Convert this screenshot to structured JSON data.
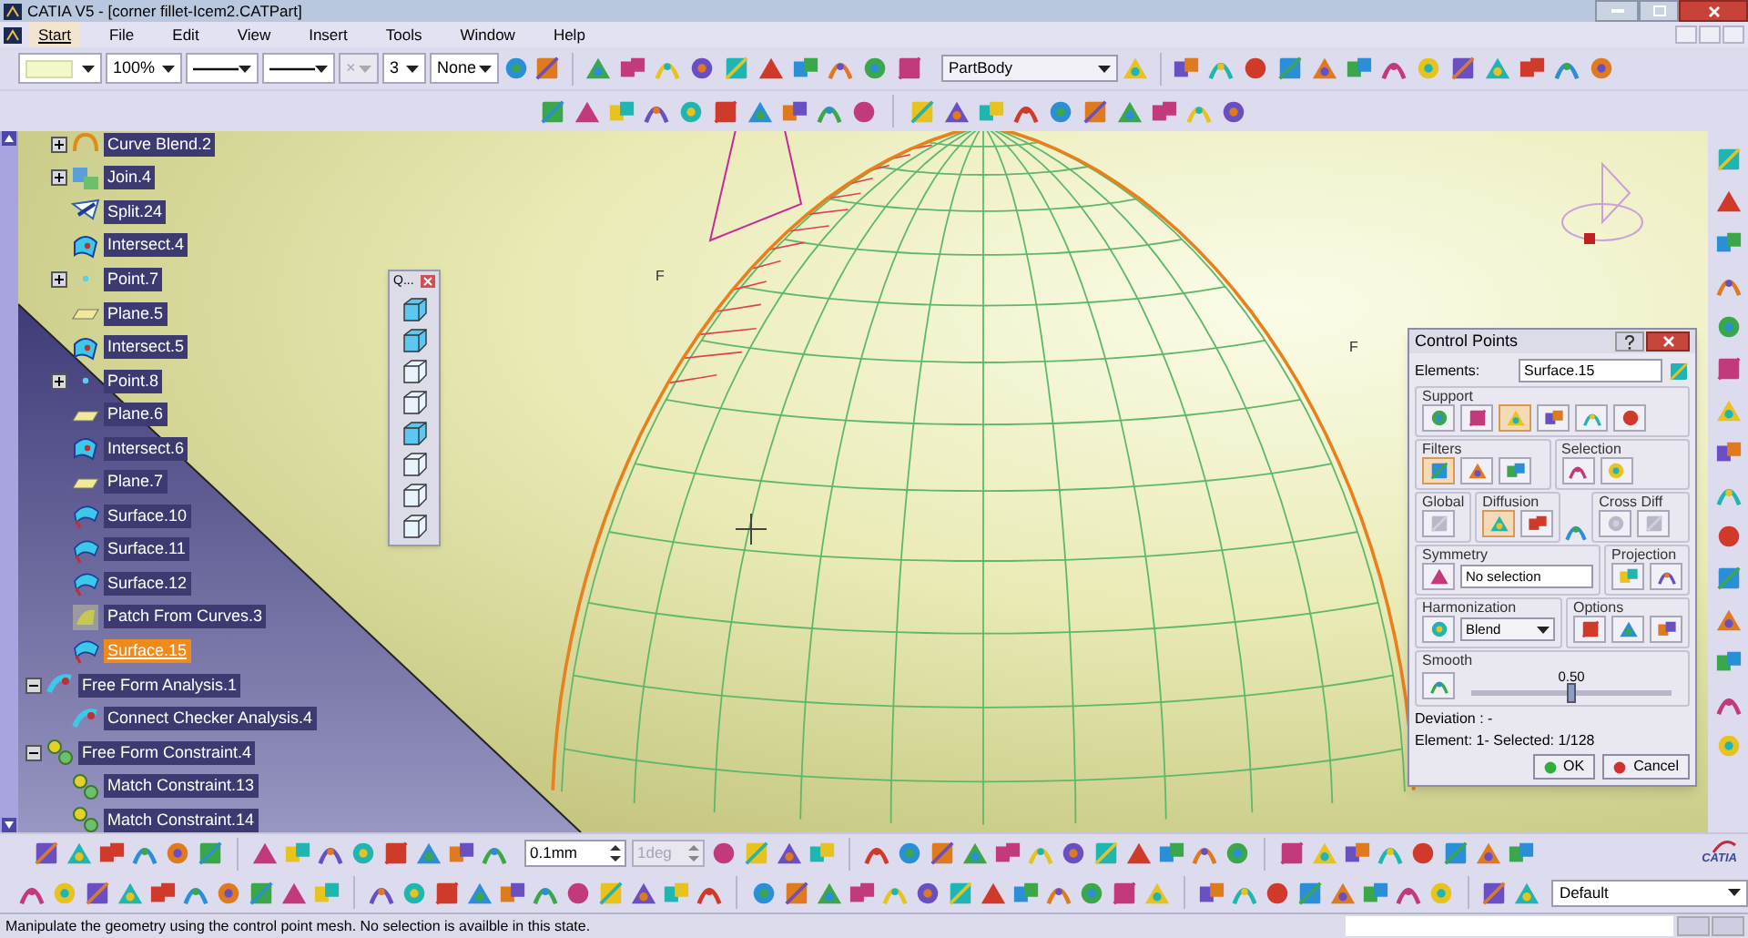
{
  "window": {
    "title": "CATIA V5 - [corner fillet-Icem2.CATPart]"
  },
  "menu": [
    {
      "label": "Start",
      "selected": true
    },
    {
      "label": "File",
      "selected": false
    },
    {
      "label": "Edit",
      "selected": false
    },
    {
      "label": "View",
      "selected": false
    },
    {
      "label": "Insert",
      "selected": false
    },
    {
      "label": "Tools",
      "selected": false
    },
    {
      "label": "Window",
      "selected": false
    },
    {
      "label": "Help",
      "selected": false
    }
  ],
  "graphic_properties": [
    {
      "kind": "swatch",
      "disabled": false
    },
    {
      "kind": "text",
      "value": "100%",
      "disabled": false
    },
    {
      "kind": "line",
      "disabled": false
    },
    {
      "kind": "line",
      "disabled": false
    },
    {
      "kind": "text",
      "value": "×",
      "disabled": true
    },
    {
      "kind": "text",
      "value": "3",
      "disabled": false
    },
    {
      "kind": "text",
      "value": "None",
      "disabled": false
    }
  ],
  "body_selector": "PartBody",
  "tree": [
    {
      "children": [
        {
          "label": "Curve Blend.2",
          "kind": "curve",
          "collapsed": true,
          "selected": false
        },
        {
          "label": "Join.4",
          "kind": "join",
          "collapsed": true,
          "selected": false
        },
        {
          "label": "Split.24",
          "kind": "split",
          "collapsed": false,
          "selected": false
        },
        {
          "label": "Intersect.4",
          "kind": "intersect",
          "collapsed": false,
          "selected": false
        },
        {
          "label": "Point.7",
          "kind": "point",
          "collapsed": true,
          "selected": false
        },
        {
          "label": "Plane.5",
          "kind": "plane",
          "collapsed": false,
          "selected": false
        },
        {
          "label": "Intersect.5",
          "kind": "intersect",
          "collapsed": false,
          "selected": false
        },
        {
          "label": "Point.8",
          "kind": "point",
          "collapsed": true,
          "selected": false
        },
        {
          "label": "Plane.6",
          "kind": "plane",
          "collapsed": false,
          "selected": false
        },
        {
          "label": "Intersect.6",
          "kind": "intersect",
          "collapsed": false,
          "selected": false
        },
        {
          "label": "Plane.7",
          "kind": "plane",
          "collapsed": false,
          "selected": false
        },
        {
          "label": "Surface.10",
          "kind": "surface",
          "collapsed": false,
          "selected": false
        },
        {
          "label": "Surface.11",
          "kind": "surface",
          "collapsed": false,
          "selected": false
        },
        {
          "label": "Surface.12",
          "kind": "surface",
          "collapsed": false,
          "selected": false
        },
        {
          "label": "Patch From Curves.3",
          "kind": "patch",
          "collapsed": false,
          "selected": false
        },
        {
          "label": "Surface.15",
          "kind": "surface",
          "collapsed": false,
          "selected": true
        }
      ]
    },
    {
      "label": "Free Form Analysis.1",
      "kind": "analysis",
      "expanded": true,
      "selected": false,
      "children": [
        {
          "label": "Connect Checker Analysis.4",
          "kind": "analysis",
          "collapsed": false,
          "selected": false
        }
      ]
    },
    {
      "label": "Free Form Constraint.4",
      "kind": "constraint",
      "expanded": true,
      "selected": false,
      "children": [
        {
          "label": "Match Constraint.13",
          "kind": "constraint",
          "collapsed": false,
          "selected": false
        },
        {
          "label": "Match Constraint.14",
          "kind": "constraint",
          "collapsed": false,
          "selected": false
        }
      ]
    }
  ],
  "viewport": {
    "labels": [
      {
        "text": "F"
      },
      {
        "text": "F"
      }
    ]
  },
  "quick_view": {
    "title": "Q..."
  },
  "control_points": {
    "title": "Control Points",
    "elements_label": "Elements:",
    "elements_value": "Surface.15",
    "support": {
      "title": "Support",
      "tools": [
        {
          "selected": false
        },
        {
          "selected": false
        },
        {
          "selected": true
        },
        {
          "selected": false
        },
        {
          "selected": false
        },
        {
          "selected": false
        }
      ]
    },
    "filters": {
      "title": "Filters",
      "tools": [
        {
          "selected": true
        },
        {
          "selected": false
        },
        {
          "selected": false
        }
      ]
    },
    "selection": {
      "title": "Selection",
      "tools": [
        {
          "selected": false
        },
        {
          "selected": false
        }
      ]
    },
    "global": {
      "title": "Global",
      "tools": [
        {
          "disabled": true
        }
      ]
    },
    "diffusion": {
      "title": "Diffusion",
      "tools": [
        {
          "selected": true
        },
        {
          "selected": false
        }
      ]
    },
    "cross_diff": {
      "title": "Cross Diff",
      "tools": [
        {
          "disabled": true
        },
        {
          "disabled": true
        }
      ]
    },
    "symmetry": {
      "title": "Symmetry",
      "value": "No selection"
    },
    "projection": {
      "title": "Projection"
    },
    "harmonization": {
      "title": "Harmonization",
      "value": "Blend"
    },
    "options": {
      "title": "Options"
    },
    "smooth": {
      "title": "Smooth",
      "level": 0.5,
      "reading": "0.50"
    },
    "deviation": "Deviation : -",
    "element_info": "Element: 1- Selected: 1/128",
    "buttons": [
      {
        "label": "OK",
        "kind": "ok"
      },
      {
        "label": "Cancel",
        "kind": "cancel"
      }
    ]
  },
  "precision": {
    "step": "0.1mm",
    "angle": "1deg",
    "angle_disabled": true
  },
  "render_style": "Default",
  "logo": "CATIA",
  "status_bar": {
    "message": "Manipulate the geometry using the control point mesh. No selection is availble in this state."
  }
}
